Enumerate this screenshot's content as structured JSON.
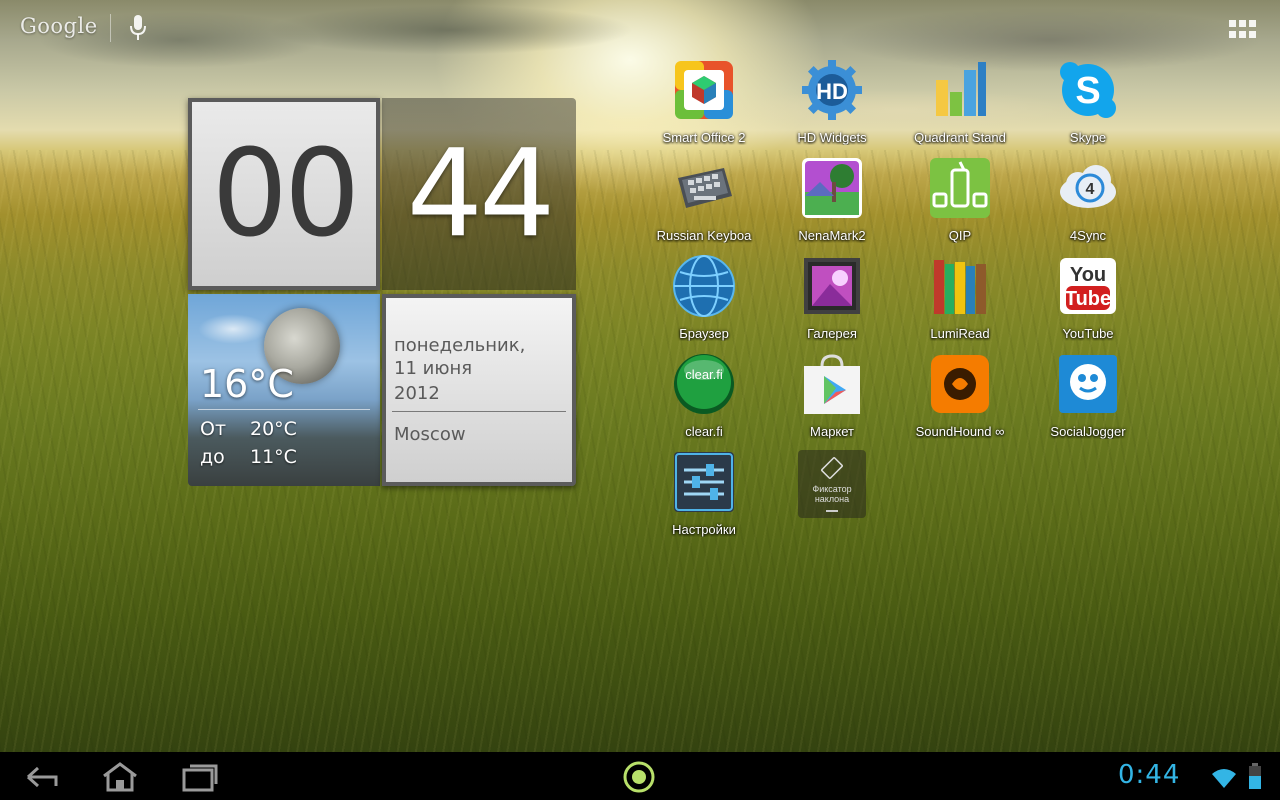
{
  "top_bar": {
    "search_logo": "Google",
    "icons": [
      "mic-icon",
      "all-apps-icon"
    ]
  },
  "clock": {
    "hours": "00",
    "minutes": "44"
  },
  "weather": {
    "condition_icon": "moon-icon",
    "current_temp": "16°C",
    "from_label": "От",
    "from_value": "20°C",
    "to_label": "до",
    "to_value": "11°C"
  },
  "date": {
    "weekday": "понедельник,",
    "day_month": "11 июня",
    "year": "2012",
    "city": "Moscow"
  },
  "apps": [
    {
      "label": "Smart Office 2",
      "icon": "smart-office-icon"
    },
    {
      "label": "HD Widgets",
      "icon": "hd-widgets-icon"
    },
    {
      "label": "Quadrant Stand",
      "icon": "quadrant-icon"
    },
    {
      "label": "Skype",
      "icon": "skype-icon"
    },
    {
      "label": "Russian Keyboa",
      "icon": "keyboard-icon"
    },
    {
      "label": "NenaMark2",
      "icon": "nenamark-icon"
    },
    {
      "label": "QIP",
      "icon": "qip-icon"
    },
    {
      "label": "4Sync",
      "icon": "4sync-icon"
    },
    {
      "label": "Браузер",
      "icon": "browser-globe-icon"
    },
    {
      "label": "Галерея",
      "icon": "gallery-icon"
    },
    {
      "label": "LumiRead",
      "icon": "books-icon"
    },
    {
      "label": "YouTube",
      "icon": "youtube-icon"
    },
    {
      "label": "clear.fi",
      "icon": "clearfi-icon"
    },
    {
      "label": "Маркет",
      "icon": "market-icon"
    },
    {
      "label": "SoundHound ∞",
      "icon": "soundhound-icon"
    },
    {
      "label": "SocialJogger",
      "icon": "socialjogger-icon"
    },
    {
      "label": "Настройки",
      "icon": "settings-sliders-icon"
    }
  ],
  "rotation_lock_widget": {
    "text": "Фиксатор наклона",
    "icon": "rotation-lock-icon"
  },
  "navbar": {
    "buttons": [
      "back-icon",
      "home-icon",
      "recent-apps-icon"
    ],
    "center_icon": "notification-dot-icon",
    "time": "0:44",
    "status_icons": [
      "wifi-icon",
      "battery-icon"
    ]
  },
  "colors": {
    "status_accent": "#33b5e5",
    "notification_dot": "#b8e06a"
  }
}
